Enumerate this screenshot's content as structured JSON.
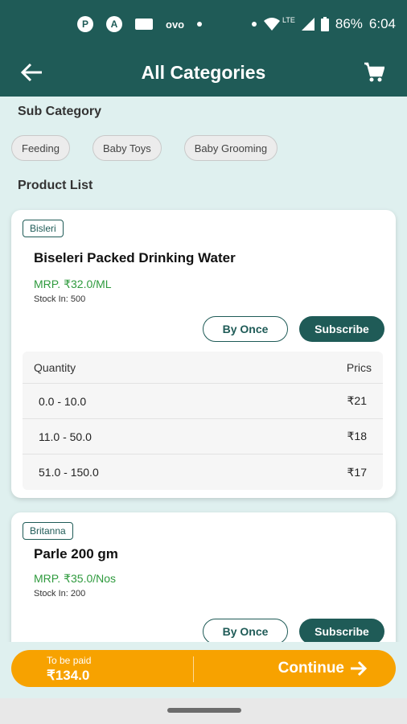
{
  "status_bar": {
    "icons_left": [
      "notification-icon-1",
      "notification-icon-2",
      "notification-icon-3",
      "ovo-icon",
      "dot-icon",
      "dot-icon"
    ],
    "ovo_label": "ovo",
    "lte": "LTE",
    "battery": "86%",
    "time": "6:04"
  },
  "app_bar": {
    "title": "All Categories",
    "back_icon": "arrow-left-icon",
    "cart_icon": "cart-icon"
  },
  "sub_category": {
    "label": "Sub Category",
    "chips": [
      "Feeding",
      "Baby Toys",
      "Baby Grooming"
    ]
  },
  "product_list": {
    "label": "Product List",
    "products": [
      {
        "brand": "Bisleri",
        "name": "Biseleri Packed Drinking Water",
        "mrp": "MRP. ₹32.0/ML",
        "stock": "Stock In: 500",
        "by_once_label": "By Once",
        "subscribe_label": "Subscribe",
        "table": {
          "header_qty": "Quantity",
          "header_price": "Prics",
          "rows": [
            {
              "range": "0.0 - 10.0",
              "price": "₹21"
            },
            {
              "range": "11.0 - 50.0",
              "price": "₹18"
            },
            {
              "range": "51.0 - 150.0",
              "price": "₹17"
            }
          ]
        }
      },
      {
        "brand": "Britanna",
        "name": "Parle 200 gm",
        "mrp": "MRP. ₹35.0/Nos",
        "stock": "Stock In: 200",
        "by_once_label": "By Once",
        "subscribe_label": "Subscribe"
      }
    ]
  },
  "bottom_bar": {
    "to_be_paid_label": "To be paid",
    "amount": "₹134.0",
    "continue_label": "Continue",
    "continue_icon": "arrow-right-icon"
  },
  "colors": {
    "primary": "#1f5b57",
    "accent": "#f7a200",
    "price_green": "#2e9a3d",
    "background": "#dff0ef"
  }
}
